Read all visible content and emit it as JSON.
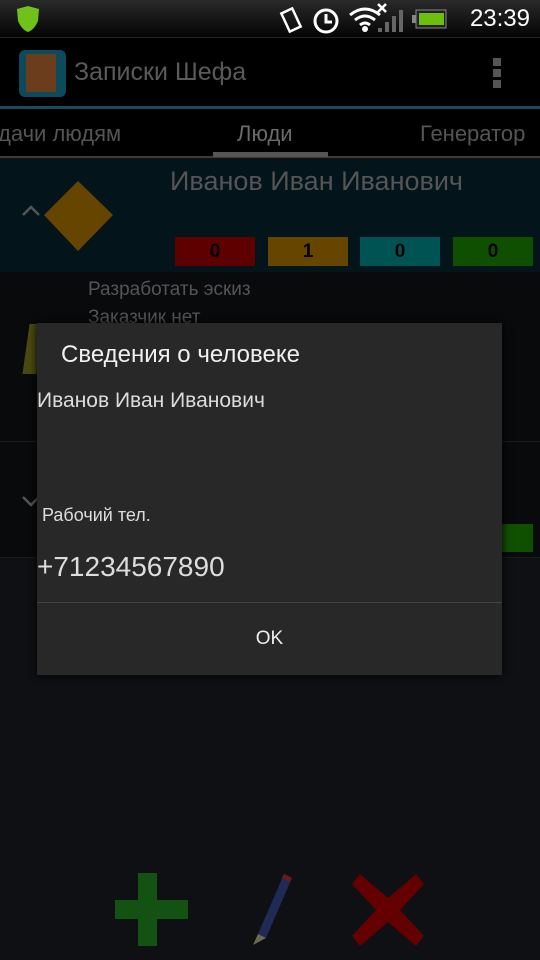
{
  "status_bar": {
    "time": "23:39",
    "icons": [
      "antivirus-shield-icon",
      "vibrate-icon",
      "alarm-icon",
      "wifi-icon",
      "signal-icon",
      "battery-icon"
    ]
  },
  "action_bar": {
    "title": "Записки Шефа",
    "menu_icon": "overflow-menu-icon"
  },
  "tabs": [
    {
      "label": "дачи людям"
    },
    {
      "label": "Люди",
      "selected": true
    },
    {
      "label": "Генератор"
    }
  ],
  "person": {
    "name": "Иванов Иван Иванович",
    "counters": [
      {
        "value": "0",
        "color": "#5e0000"
      },
      {
        "value": "1",
        "color": "#654500"
      },
      {
        "value": "0",
        "color": "#005353"
      },
      {
        "value": "0",
        "color": "#0f4f00"
      }
    ]
  },
  "task": {
    "title": "Разработать эскиз",
    "customer": "Заказчик нет"
  },
  "dialog": {
    "title": "Сведения о человеке",
    "name": "Иванов Иван Иванович",
    "phone_label": "Рабочий тел.",
    "phone": "+71234567890",
    "ok_label": "OK"
  },
  "bottom_bar": {
    "add": "add-icon",
    "edit": "pencil-icon",
    "delete": "delete-icon"
  }
}
